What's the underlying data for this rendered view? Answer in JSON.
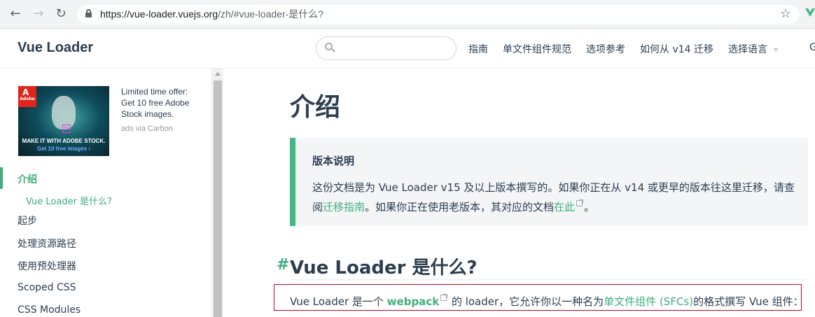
{
  "browser": {
    "url_host": "https://vue-loader.vuejs.org",
    "url_path": "/zh/#vue-loader-是什么?",
    "back_icon": "←",
    "forward_icon": "→",
    "reload_icon": "↻",
    "star_icon": "☆"
  },
  "header": {
    "site_title": "Vue Loader",
    "search_placeholder": "",
    "nav": [
      "指南",
      "单文件组件规范",
      "选项参考",
      "如何从 v14 迁移",
      "选择语言"
    ],
    "nav_cut": "G"
  },
  "ad": {
    "badge": "Adobe",
    "badge_letter": "A",
    "st_label": "St",
    "line1": "MAKE IT WITH ADOBE STOCK.",
    "line2": "Get 10 free images ›",
    "text": "Limited time offer: Get 10 free Adobe Stock images.",
    "via": "ads via Carbon"
  },
  "sidebar": {
    "items": [
      "介绍",
      "Vue Loader 是什么?",
      "起步",
      "处理资源路径",
      "使用预处理器",
      "Scoped CSS",
      "CSS Modules"
    ]
  },
  "content": {
    "title": "介绍",
    "tip_title": "版本说明",
    "tip_text_1": "这份文档是为 Vue Loader v15 及以上版本撰写的。如果你正在从 v14 或更早的版本往这里迁移，请查阅",
    "tip_link_1": "迁移指南",
    "tip_text_2": "。如果你正在使用老版本，其对应的文档",
    "tip_link_2": "在此",
    "tip_text_3": "。",
    "h2_anchor": "#",
    "h2": "Vue Loader 是什么?",
    "para_1": "Vue Loader 是一个 ",
    "para_link_1": "webpack",
    "para_2": " 的 loader，它允许你以一种名为",
    "para_link_2": "单文件组件 (SFCs)",
    "para_3": "的格式撰写 Vue 组件："
  },
  "colors": {
    "accent": "#3eaf7c",
    "tip_border": "#42b983",
    "highlight_border": "#d0021b"
  }
}
